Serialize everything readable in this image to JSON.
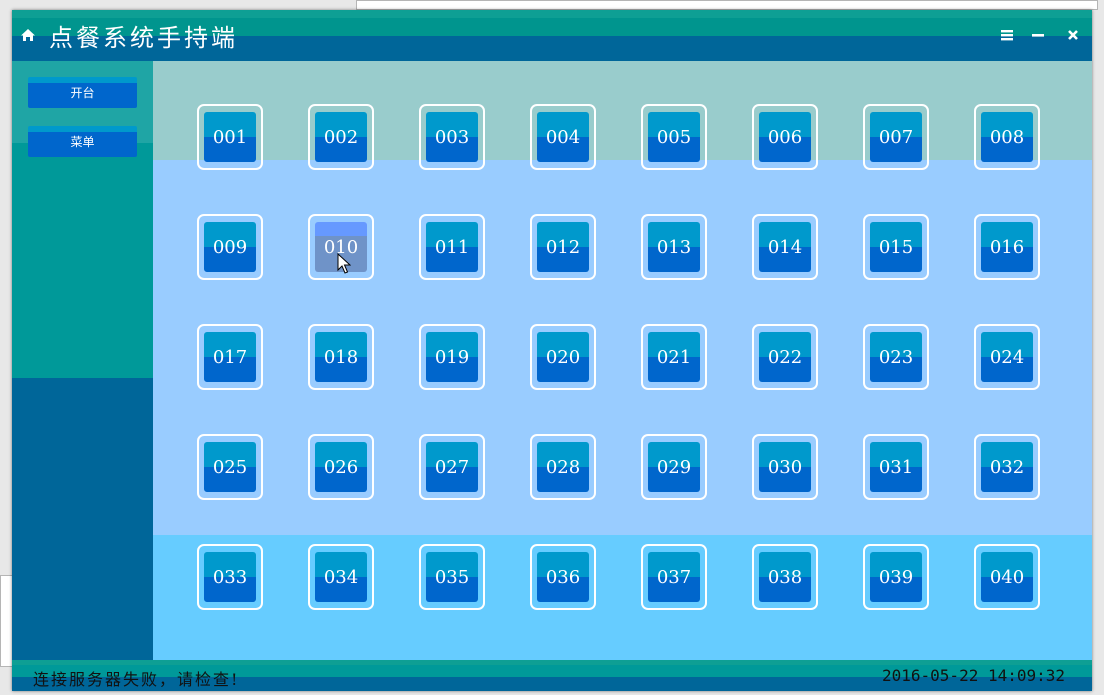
{
  "app": {
    "title": "点餐系统手持端"
  },
  "window_controls": {
    "menu": "≡",
    "minimize": "−",
    "close": "×"
  },
  "sidebar": {
    "items": [
      {
        "label": "开台"
      },
      {
        "label": "菜单"
      }
    ]
  },
  "tables": {
    "rows": [
      [
        "001",
        "002",
        "003",
        "004",
        "005",
        "006",
        "007",
        "008"
      ],
      [
        "009",
        "010",
        "011",
        "012",
        "013",
        "014",
        "015",
        "016"
      ],
      [
        "017",
        "018",
        "019",
        "020",
        "021",
        "022",
        "023",
        "024"
      ],
      [
        "025",
        "026",
        "027",
        "028",
        "029",
        "030",
        "031",
        "032"
      ],
      [
        "033",
        "034",
        "035",
        "036",
        "037",
        "038",
        "039",
        "040"
      ]
    ],
    "hovered": "010"
  },
  "statusbar": {
    "message": "连接服务器失败，请检查!",
    "datetime": "2016-05-22 14:09:32"
  },
  "colors": {
    "titlebar": "#00958e",
    "sidebar_top": "#009999",
    "sidebar_bottom": "#006699",
    "band_top": "#99cccc",
    "band_middle": "#99ccff",
    "band_bottom": "#66ccff",
    "button_top": "#0099cc",
    "button_bottom": "#0066cc"
  }
}
